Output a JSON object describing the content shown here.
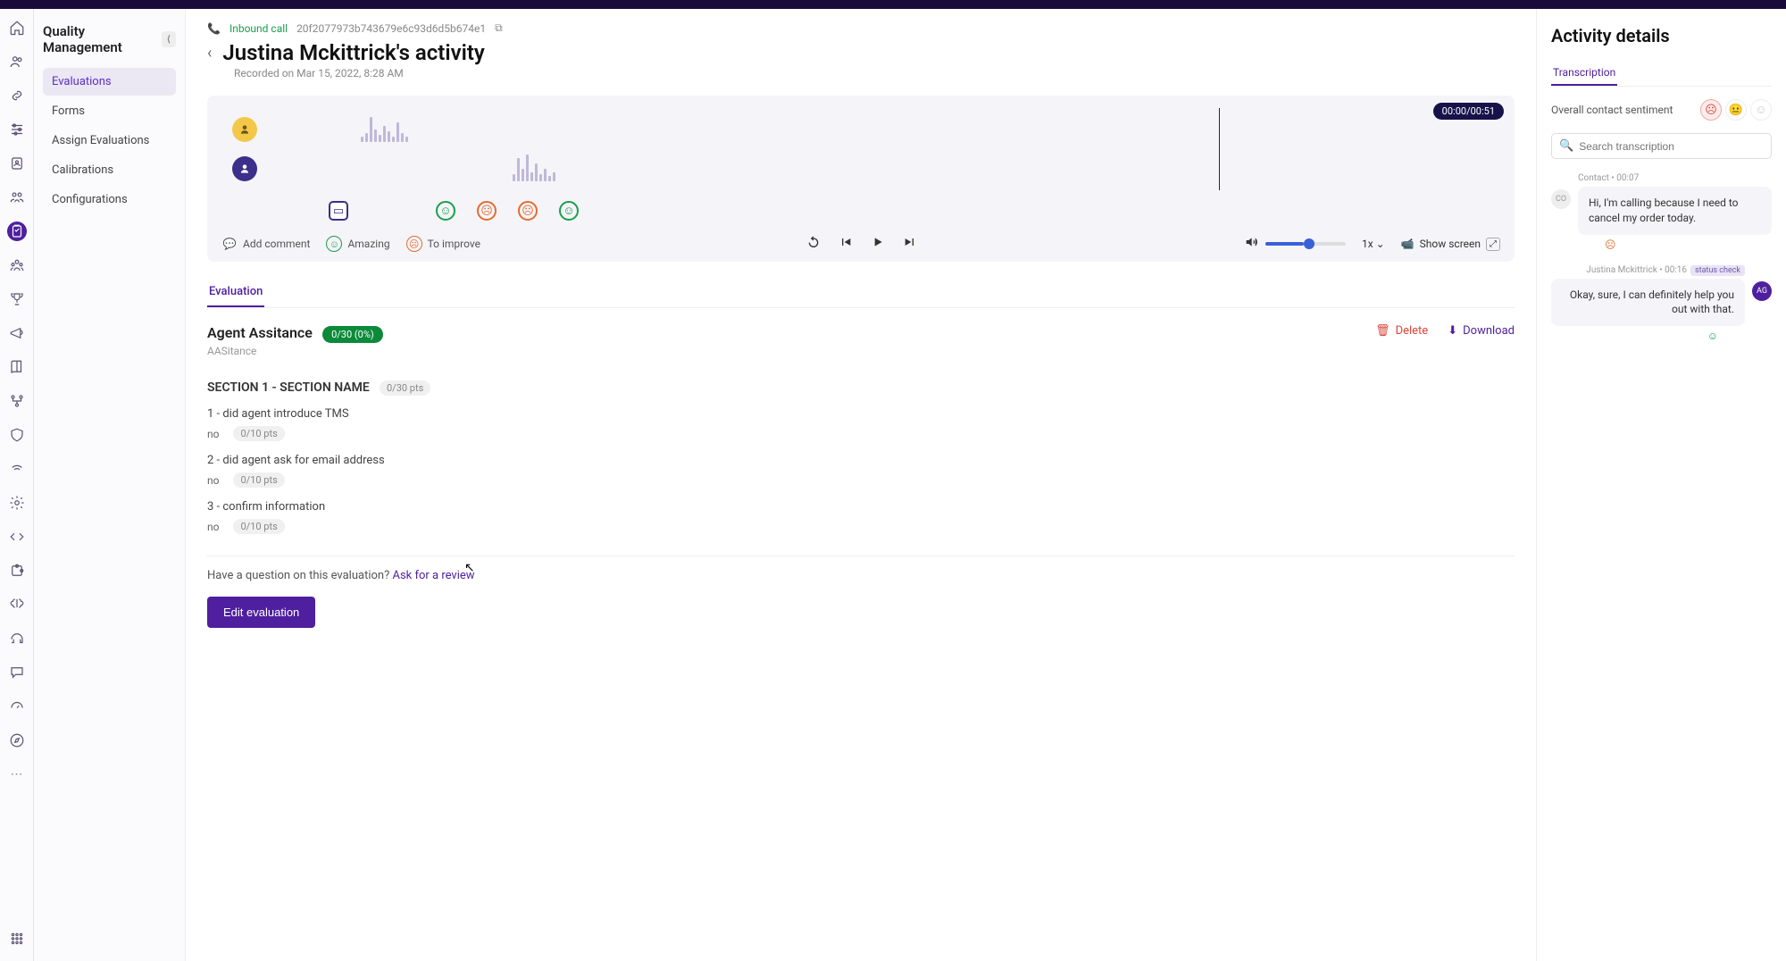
{
  "sidebar": {
    "title": "Quality Management",
    "items": [
      "Evaluations",
      "Forms",
      "Assign Evaluations",
      "Calibrations",
      "Configurations"
    ]
  },
  "header": {
    "call_label": "Inbound call",
    "call_id": "20f2077973b743679e6c93d6d5b674e1",
    "title": "Justina Mckittrick's activity",
    "subtitle": "Recorded on Mar 15, 2022, 8:28 AM"
  },
  "player": {
    "time": "00:00/00:51",
    "add_comment": "Add comment",
    "amazing": "Amazing",
    "to_improve": "To improve",
    "speed": "1x",
    "show_screen": "Show screen"
  },
  "eval": {
    "tab": "Evaluation",
    "name": "Agent Assitance",
    "score": "0/30 (0%)",
    "sub": "AASitance",
    "delete": "Delete",
    "download": "Download",
    "section_title": "SECTION 1 - SECTION NAME",
    "section_pts": "0/30 pts",
    "questions": [
      {
        "text": "1 - did agent introduce TMS",
        "ans": "no",
        "pts": "0/10 pts"
      },
      {
        "text": "2 - did agent ask for email address",
        "ans": "no",
        "pts": "0/10 pts"
      },
      {
        "text": "3 - confirm information",
        "ans": "no",
        "pts": "0/10 pts"
      }
    ],
    "review_prompt": "Have a question on this evaluation? ",
    "review_link": "Ask for a review",
    "edit": "Edit evaluation"
  },
  "details": {
    "title": "Activity details",
    "tab": "Transcription",
    "sentiment_label": "Overall contact sentiment",
    "search_placeholder": "Search transcription",
    "messages": [
      {
        "side": "left",
        "meta": "Contact • 00:07",
        "text": "Hi, I'm calling because I need to cancel my order today.",
        "avatar": "CO",
        "tag": ""
      },
      {
        "side": "right",
        "meta": "Justina Mckittrick • 00:16",
        "text": "Okay, sure, I can definitely help you out with that.",
        "avatar": "AG",
        "tag": "status check"
      }
    ]
  }
}
